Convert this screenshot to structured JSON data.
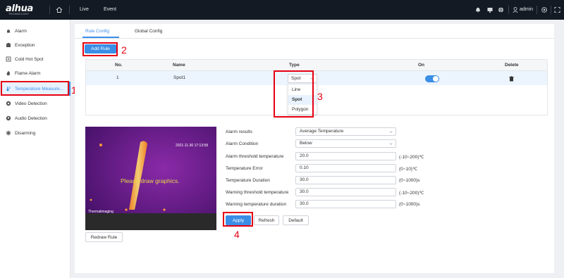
{
  "brand": {
    "logo": "alhua",
    "sub": "TECHNOLOGY"
  },
  "topnav": {
    "live": "Live",
    "event": "Event",
    "user": "admin"
  },
  "sidebar": {
    "items": [
      {
        "label": "Alarm",
        "icon": "alarm-icon"
      },
      {
        "label": "Exception",
        "icon": "exception-icon"
      },
      {
        "label": "Cold Hot Spot",
        "icon": "cold-hot-spot-icon"
      },
      {
        "label": "Flame Alarm",
        "icon": "flame-icon"
      },
      {
        "label": "Temperature Measure...",
        "icon": "temperature-icon",
        "active": true
      },
      {
        "label": "Video Detection",
        "icon": "video-detection-icon"
      },
      {
        "label": "Audio Detection",
        "icon": "audio-detection-icon"
      },
      {
        "label": "Disarming",
        "icon": "disarming-icon"
      }
    ]
  },
  "tabs": {
    "rule_config": "Rule Config",
    "global_config": "Global Config"
  },
  "add_rule": "Add Rule",
  "table": {
    "headers": {
      "no": "No.",
      "name": "Name",
      "type": "Type",
      "on": "On",
      "delete": "Delete"
    },
    "rows": [
      {
        "no": "1",
        "name": "Spot1",
        "type": "Spot",
        "on": true
      }
    ]
  },
  "type_dropdown": {
    "options": [
      "Line",
      "Spot",
      "Polygon"
    ],
    "selected": "Spot"
  },
  "preview": {
    "overlay": "Please draw graphics.",
    "timestamp": "2021-11-30 17:13:58",
    "watermark": "Thermalimaging"
  },
  "redraw_rule": "Redraw Rule",
  "form": {
    "alarm_results": {
      "label": "Alarm results",
      "value": "Average Temperature"
    },
    "alarm_condition": {
      "label": "Alarm Condition",
      "value": "Below"
    },
    "alarm_threshold": {
      "label": "Alarm threshold temperature",
      "value": "20.0",
      "range": "(-10~200)℃"
    },
    "temp_error": {
      "label": "Temperature Error",
      "value": "0.10",
      "range": "(0~10)℃"
    },
    "temp_duration": {
      "label": "Temperature Duration",
      "value": "30.0",
      "range": "(0~1000)s"
    },
    "warning_threshold": {
      "label": "Warning threshold temperature",
      "value": "30.0",
      "range": "(-10~200)℃"
    },
    "warning_duration": {
      "label": "Warning temperature duration",
      "value": "30.0",
      "range": "(0~1000)s"
    }
  },
  "buttons": {
    "apply": "Apply",
    "refresh": "Refresh",
    "default": "Default"
  },
  "annotations": {
    "n1": "1",
    "n2": "2",
    "n3": "3",
    "n4": "4"
  },
  "colors": {
    "accent": "#3a8ee6",
    "topbar": "#131a24",
    "annotation": "#e60012"
  }
}
